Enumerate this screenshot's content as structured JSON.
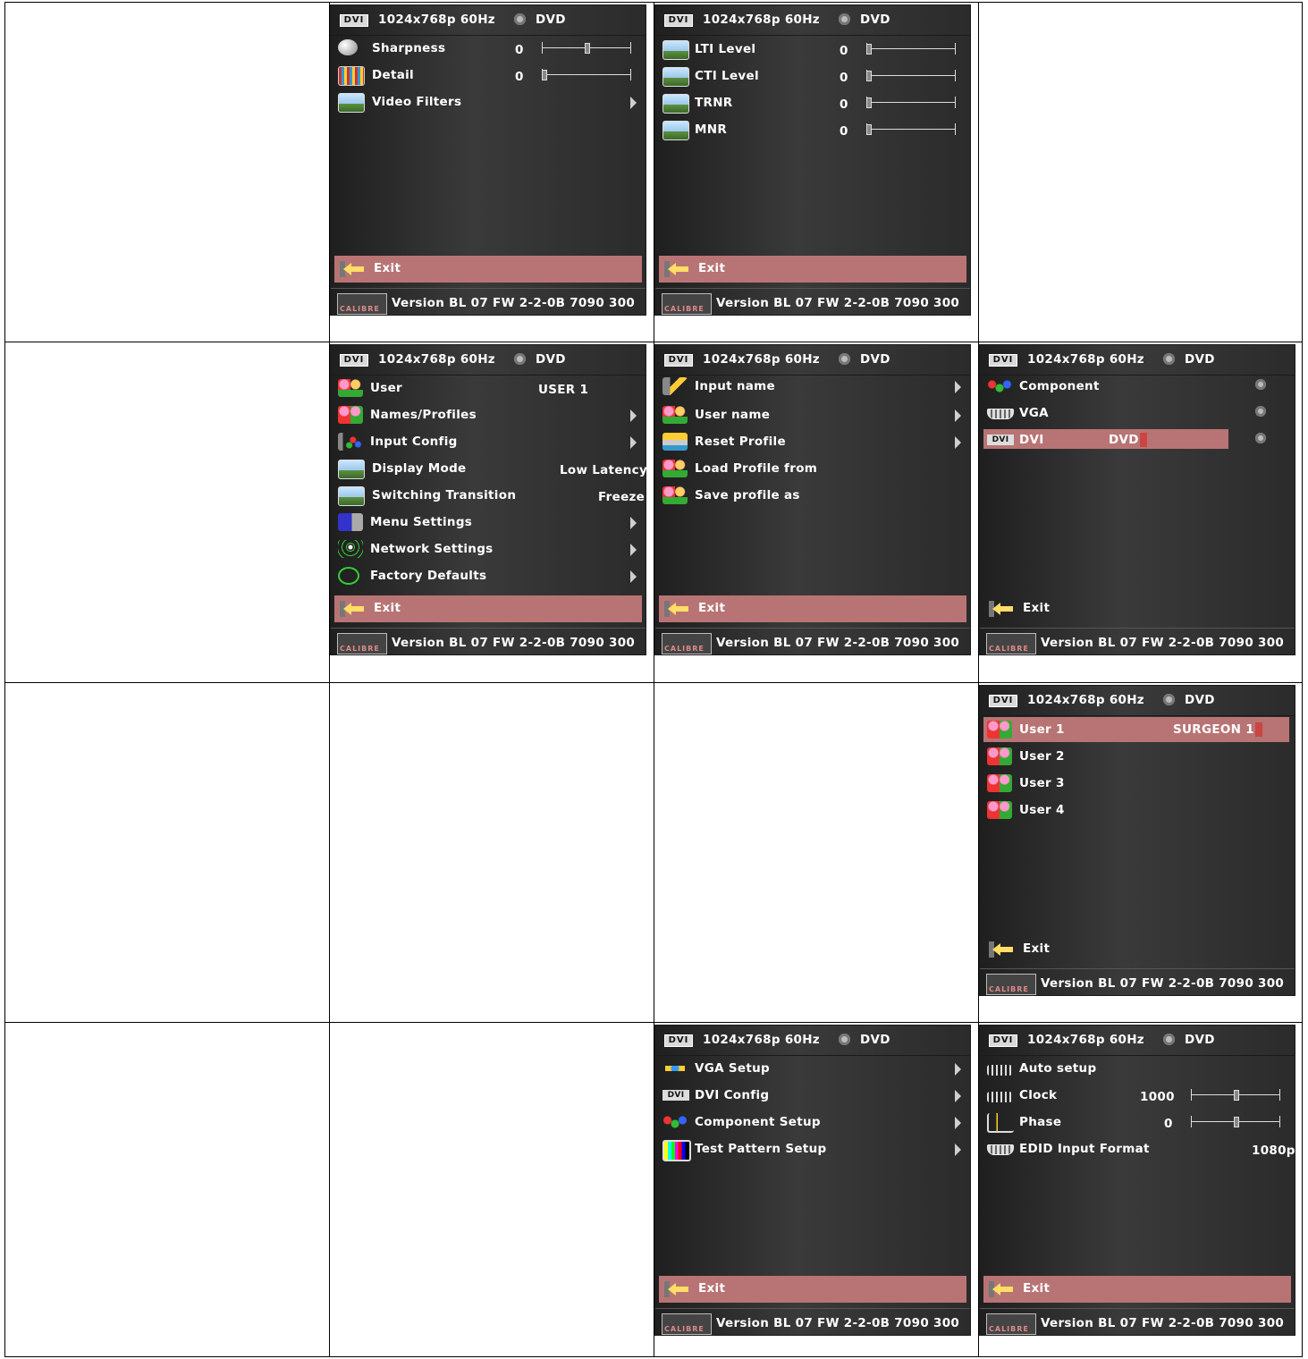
{
  "header": {
    "badge": "DVI",
    "resolution": "1024x768p 60Hz",
    "source": "DVD"
  },
  "footer": {
    "logo": "CALIBRE",
    "version": "Version BL 07 FW 2-2-0B 7090 300"
  },
  "exit_label": "Exit",
  "panels": {
    "sharpness": {
      "rows": [
        {
          "label": "Sharpness",
          "value": "0"
        },
        {
          "label": "Detail",
          "value": "0"
        },
        {
          "label": "Video Filters"
        }
      ]
    },
    "filters": {
      "rows": [
        {
          "label": "LTI Level",
          "value": "0"
        },
        {
          "label": "CTI Level",
          "value": "0"
        },
        {
          "label": "TRNR",
          "value": "0"
        },
        {
          "label": "MNR",
          "value": "0"
        }
      ]
    },
    "main": {
      "rows": [
        {
          "label": "User",
          "value": "USER 1"
        },
        {
          "label": "Names/Profiles"
        },
        {
          "label": "Input Config"
        },
        {
          "label": "Display Mode",
          "value": "Low Latency"
        },
        {
          "label": "Switching Transition",
          "value": "Freeze"
        },
        {
          "label": "Menu Settings"
        },
        {
          "label": "Network Settings"
        },
        {
          "label": "Factory Defaults"
        }
      ]
    },
    "names": {
      "rows": [
        {
          "label": "Input name"
        },
        {
          "label": "User name"
        },
        {
          "label": "Reset Profile"
        },
        {
          "label": "Load Profile from"
        },
        {
          "label": "Save profile as"
        }
      ]
    },
    "inputs": {
      "rows": [
        {
          "label": "Component"
        },
        {
          "label": "VGA"
        },
        {
          "label": "DVI",
          "value": "DVD"
        }
      ]
    },
    "users": {
      "rows": [
        {
          "label": "User 1",
          "value": "SURGEON  1"
        },
        {
          "label": "User 2"
        },
        {
          "label": "User 3"
        },
        {
          "label": "User 4"
        }
      ]
    },
    "config": {
      "rows": [
        {
          "label": "VGA Setup"
        },
        {
          "label": "DVI Config"
        },
        {
          "label": "Component Setup"
        },
        {
          "label": "Test Pattern Setup"
        }
      ]
    },
    "vga": {
      "rows": [
        {
          "label": "Auto setup"
        },
        {
          "label": "Clock",
          "value": "1000"
        },
        {
          "label": "Phase",
          "value": "0"
        },
        {
          "label": "EDID Input Format",
          "value": "1080p"
        }
      ]
    }
  },
  "sliders": {
    "sharpness": {
      "fraction": 0.5
    },
    "detail": {
      "fraction": 0.0
    },
    "lti": {
      "fraction": 0.0
    },
    "cti": {
      "fraction": 0.0
    },
    "trnr": {
      "fraction": 0.0
    },
    "mnr": {
      "fraction": 0.0
    },
    "clock": {
      "fraction": 0.5
    },
    "phase": {
      "fraction": 0.5
    }
  }
}
